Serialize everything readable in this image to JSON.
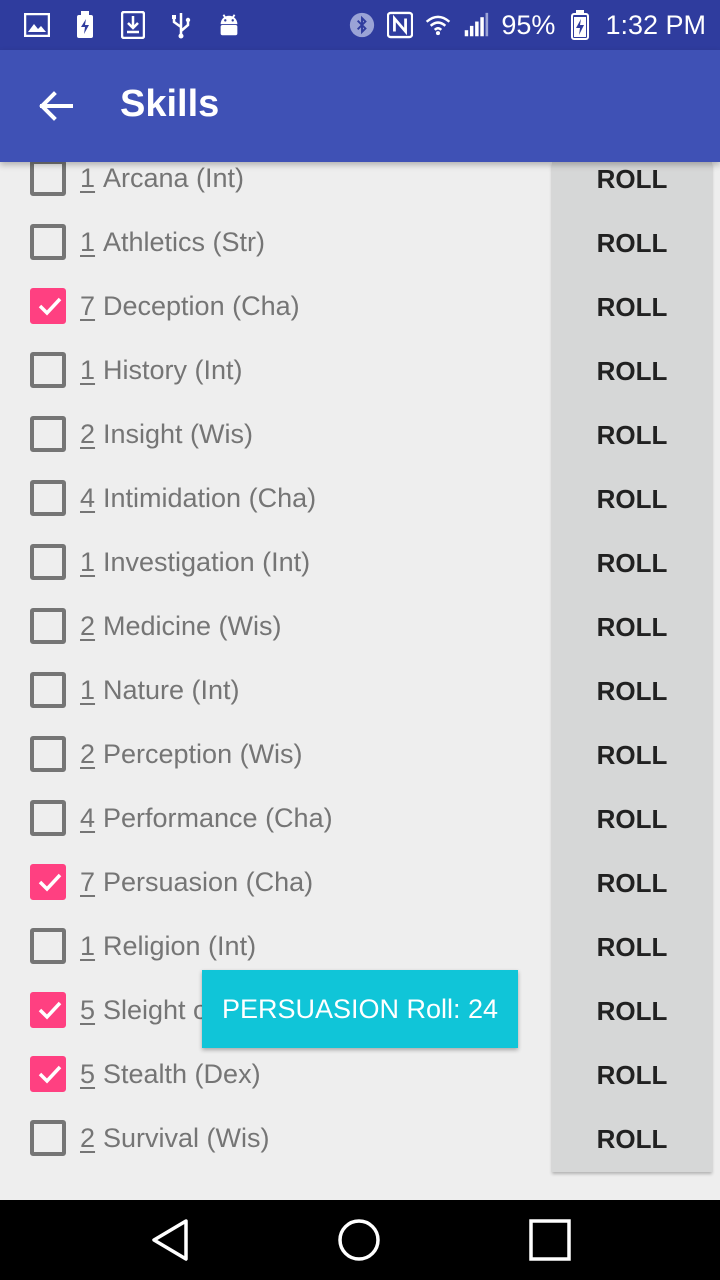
{
  "status_bar": {
    "icons_left": [
      "gallery-icon",
      "battery-charging-icon",
      "download-icon",
      "usb-icon",
      "android-icon"
    ],
    "icons_right": [
      "bluetooth-icon",
      "nfc-icon",
      "wifi-icon",
      "signal-icon"
    ],
    "battery": "95%",
    "time": "1:32 PM"
  },
  "app_bar": {
    "title": "Skills",
    "back_icon": "arrow-back-icon"
  },
  "skills": [
    {
      "num": "1",
      "label": "Arcana (Int)",
      "checked": false,
      "roll": "ROLL"
    },
    {
      "num": "1",
      "label": "Athletics (Str)",
      "checked": false,
      "roll": "ROLL"
    },
    {
      "num": "7",
      "label": "Deception (Cha)",
      "checked": true,
      "roll": "ROLL"
    },
    {
      "num": "1",
      "label": "History (Int)",
      "checked": false,
      "roll": "ROLL"
    },
    {
      "num": "2",
      "label": "Insight (Wis)",
      "checked": false,
      "roll": "ROLL"
    },
    {
      "num": "4",
      "label": "Intimidation (Cha)",
      "checked": false,
      "roll": "ROLL"
    },
    {
      "num": "1",
      "label": "Investigation (Int)",
      "checked": false,
      "roll": "ROLL"
    },
    {
      "num": "2",
      "label": "Medicine (Wis)",
      "checked": false,
      "roll": "ROLL"
    },
    {
      "num": "1",
      "label": "Nature (Int)",
      "checked": false,
      "roll": "ROLL"
    },
    {
      "num": "2",
      "label": "Perception (Wis)",
      "checked": false,
      "roll": "ROLL"
    },
    {
      "num": "4",
      "label": "Performance (Cha)",
      "checked": false,
      "roll": "ROLL"
    },
    {
      "num": "7",
      "label": "Persuasion (Cha)",
      "checked": true,
      "roll": "ROLL"
    },
    {
      "num": "1",
      "label": "Religion (Int)",
      "checked": false,
      "roll": "ROLL"
    },
    {
      "num": "5",
      "label": "Sleight o",
      "checked": true,
      "roll": "ROLL"
    },
    {
      "num": "5",
      "label": "Stealth (Dex)",
      "checked": true,
      "roll": "ROLL"
    },
    {
      "num": "2",
      "label": "Survival (Wis)",
      "checked": false,
      "roll": "ROLL"
    }
  ],
  "toast": {
    "text": "PERSUASION Roll: 24"
  },
  "nav_bar": {
    "back_icon": "nav-back-icon",
    "home_icon": "nav-home-icon",
    "recents_icon": "nav-recents-icon"
  },
  "colors": {
    "status_bar": "#2f3c9e",
    "app_bar": "#3f51b5",
    "checkbox_checked": "#ff4081",
    "toast": "#10c5d8",
    "roll_column": "#d6d7d7"
  }
}
